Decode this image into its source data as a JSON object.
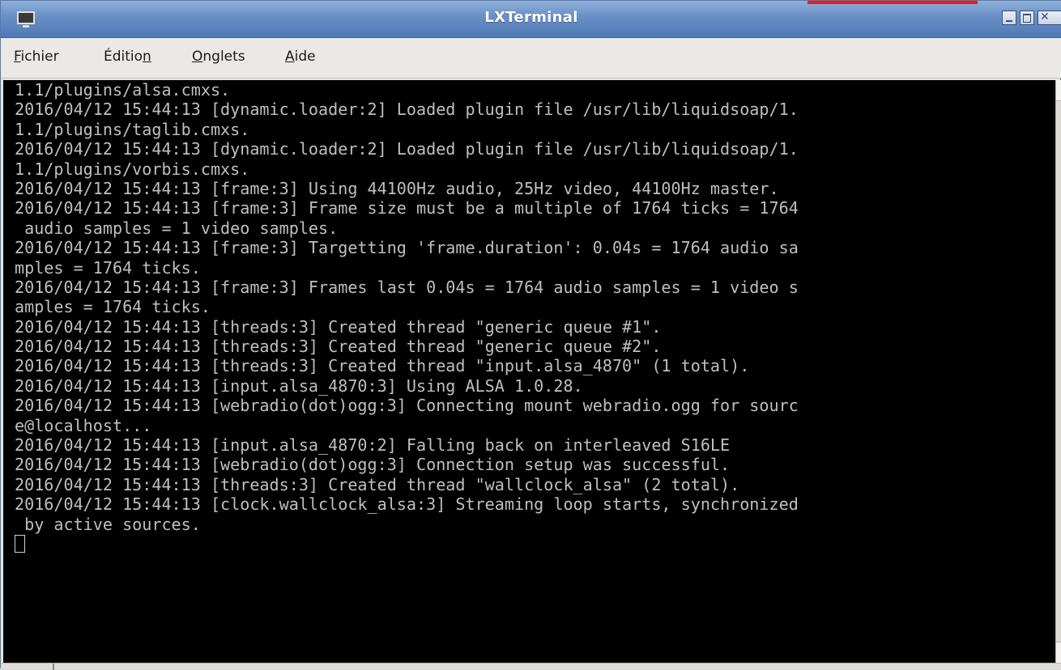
{
  "window": {
    "title": "LXTerminal",
    "accent": "#4f79b6"
  },
  "menu": [
    {
      "pre": "",
      "mn": "F",
      "post": "ichier"
    },
    {
      "pre": "Éditio",
      "mn": "n",
      "post": ""
    },
    {
      "pre": "",
      "mn": "O",
      "post": "nglets"
    },
    {
      "pre": "",
      "mn": "A",
      "post": "ide"
    }
  ],
  "terminal": {
    "background": "#000000",
    "foreground": "#bfbfbf",
    "lines": [
      "1.1/plugins/alsa.cmxs.",
      "2016/04/12 15:44:13 [dynamic.loader:2] Loaded plugin file /usr/lib/liquidsoap/1.",
      "1.1/plugins/taglib.cmxs.",
      "2016/04/12 15:44:13 [dynamic.loader:2] Loaded plugin file /usr/lib/liquidsoap/1.",
      "1.1/plugins/vorbis.cmxs.",
      "2016/04/12 15:44:13 [frame:3] Using 44100Hz audio, 25Hz video, 44100Hz master.",
      "2016/04/12 15:44:13 [frame:3] Frame size must be a multiple of 1764 ticks = 1764",
      " audio samples = 1 video samples.",
      "2016/04/12 15:44:13 [frame:3] Targetting 'frame.duration': 0.04s = 1764 audio sa",
      "mples = 1764 ticks.",
      "2016/04/12 15:44:13 [frame:3] Frames last 0.04s = 1764 audio samples = 1 video s",
      "amples = 1764 ticks.",
      "2016/04/12 15:44:13 [threads:3] Created thread \"generic queue #1\".",
      "2016/04/12 15:44:13 [threads:3] Created thread \"generic queue #2\".",
      "2016/04/12 15:44:13 [threads:3] Created thread \"input.alsa_4870\" (1 total).",
      "2016/04/12 15:44:13 [input.alsa_4870:3] Using ALSA 1.0.28.",
      "2016/04/12 15:44:13 [webradio(dot)ogg:3] Connecting mount webradio.ogg for sourc",
      "e@localhost...",
      "2016/04/12 15:44:13 [input.alsa_4870:2] Falling back on interleaved S16LE",
      "2016/04/12 15:44:13 [webradio(dot)ogg:3] Connection setup was successful.",
      "2016/04/12 15:44:13 [threads:3] Created thread \"wallclock_alsa\" (2 total).",
      "2016/04/12 15:44:13 [clock.wallclock_alsa:3] Streaming loop starts, synchronized",
      " by active sources."
    ]
  }
}
